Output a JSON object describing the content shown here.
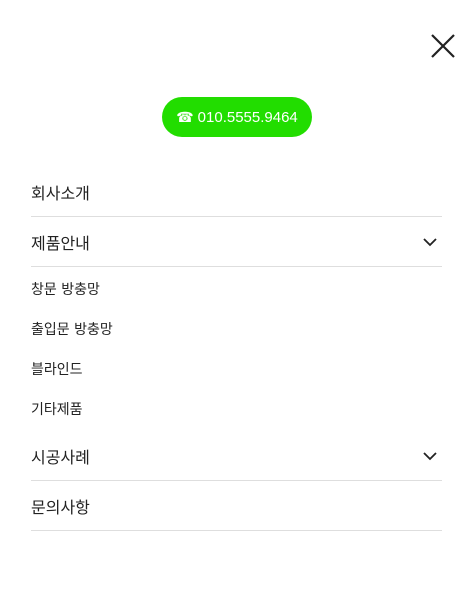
{
  "close": {
    "icon": "close-icon"
  },
  "phone": {
    "icon": "☎",
    "number": "010.5555.9464",
    "bg_color": "#22dd00"
  },
  "menu": {
    "item1": "회사소개",
    "item2": "제품안내",
    "sub": [
      "창문 방충망",
      "출입문 방충망",
      "블라인드",
      "기타제품"
    ],
    "item3": "시공사례",
    "item4": "문의사항"
  }
}
